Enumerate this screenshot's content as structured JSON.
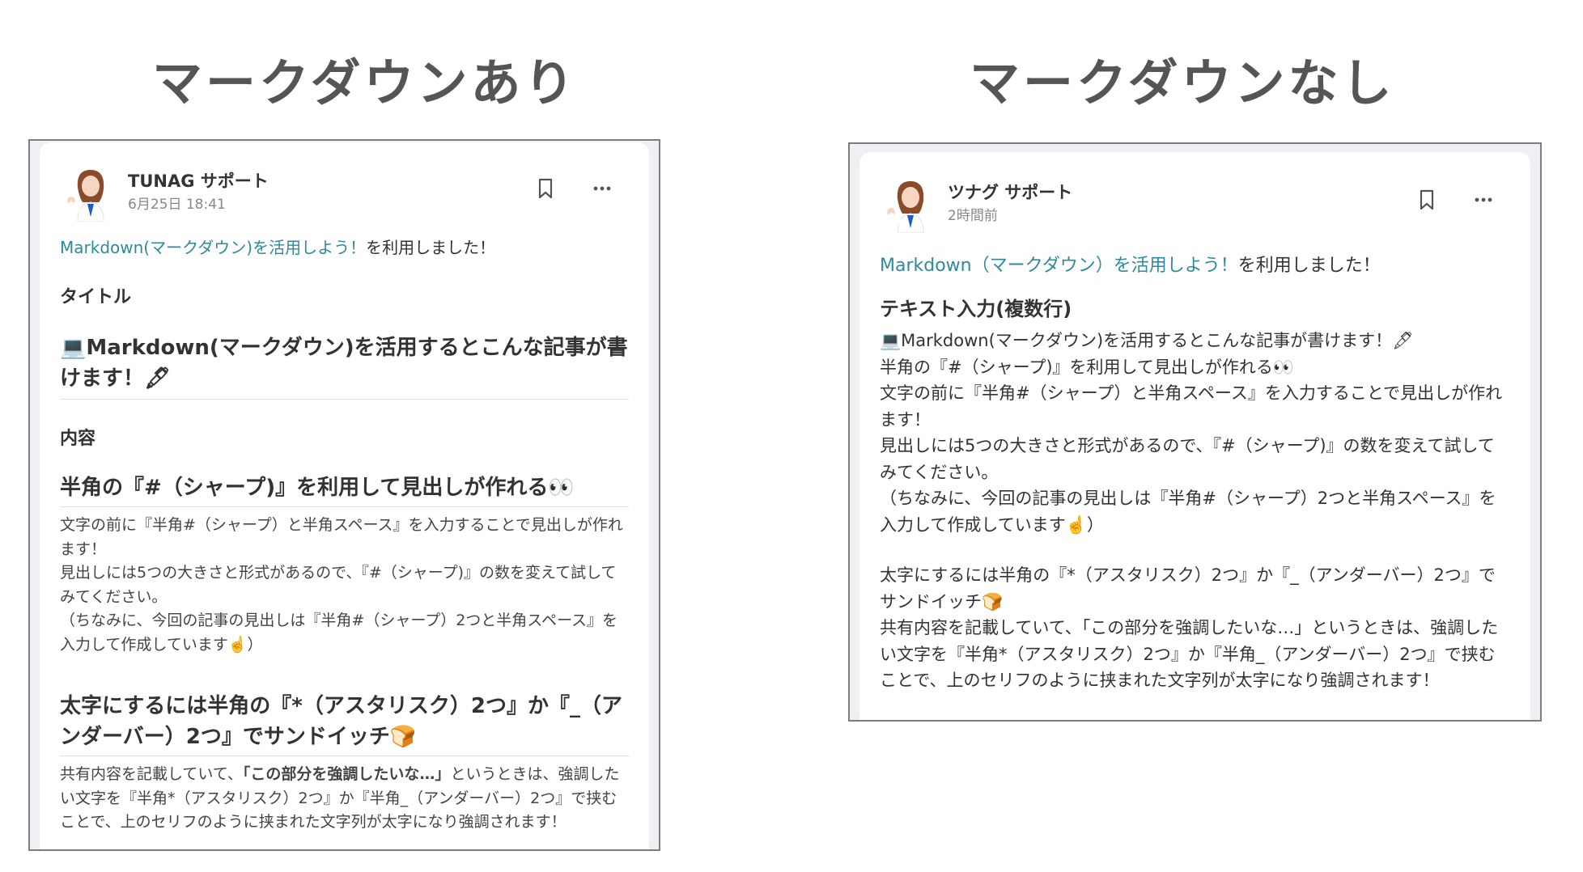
{
  "headings": {
    "left": "マークダウンあり",
    "right": "マークダウンなし"
  },
  "colors": {
    "link": "#2f8a9a",
    "frame_bg": "#eef0f3",
    "frame_border": "#7d7d7d"
  },
  "left_post": {
    "author": "TUNAG サポート",
    "time": "6月25日 18:41",
    "source_link": "Markdown(マークダウン)を活用しよう！",
    "source_suffix": "を利用しました！",
    "label_title": "タイトル",
    "title": "💻Markdown(マークダウン)を活用するとこんな記事が書けます！🖋",
    "label_content": "内容",
    "h1": "半角の『#（シャープ)』を利用して見出しが作れる👀",
    "p1": [
      "文字の前に『半角#（シャープ）と半角スペース』を入力することで見出しが作れます！",
      "見出しには5つの大きさと形式があるので、『#（シャープ)』の数を変えて試してみてください。",
      "（ちなみに、今回の記事の見出しは『半角#（シャープ）2つと半角スペース』を入力して作成しています☝️）"
    ],
    "h2": "太字にするには半角の『*（アスタリスク）2つ』か『_（アンダーバー）2つ』でサンドイッチ🍞",
    "p2_before": "共有内容を記載していて、",
    "p2_bold": "「この部分を強調したいな…」",
    "p2_after": "というときは、強調したい文字を『半角*（アスタリスク）2つ』か『半角_（アンダーバー）2つ』で挟むことで、上のセリフのように挟まれた文字列が太字になり強調されます！"
  },
  "right_post": {
    "author": "ツナグ サポート",
    "time": "2時間前",
    "source_link": "Markdown（マークダウン）を活用しよう！",
    "source_suffix": "を利用しました！",
    "title": "テキスト入力(複数行)",
    "para1": [
      "💻Markdown(マークダウン)を活用するとこんな記事が書けます！🖋",
      "半角の『#（シャープ)』を利用して見出しが作れる👀",
      "文字の前に『半角#（シャープ）と半角スペース』を入力することで見出しが作れます！",
      "見出しには5つの大きさと形式があるので、『#（シャープ)』の数を変えて試してみてください。",
      "（ちなみに、今回の記事の見出しは『半角#（シャープ）2つと半角スペース』を入力して作成しています☝️）"
    ],
    "para2": [
      "太字にするには半角の『*（アスタリスク）2つ』か『_（アンダーバー）2つ』でサンドイッチ🍞",
      "共有内容を記載していて、「この部分を強調したいな…」というときは、強調したい文字を『半角*（アスタリスク）2つ』か『半角_（アンダーバー）2つ』で挟むことで、上のセリフのように挟まれた文字列が太字になり強調されます！"
    ]
  },
  "icons": {
    "avatar": "support-avatar",
    "bookmark": "bookmark-icon",
    "more": "more-icon"
  }
}
